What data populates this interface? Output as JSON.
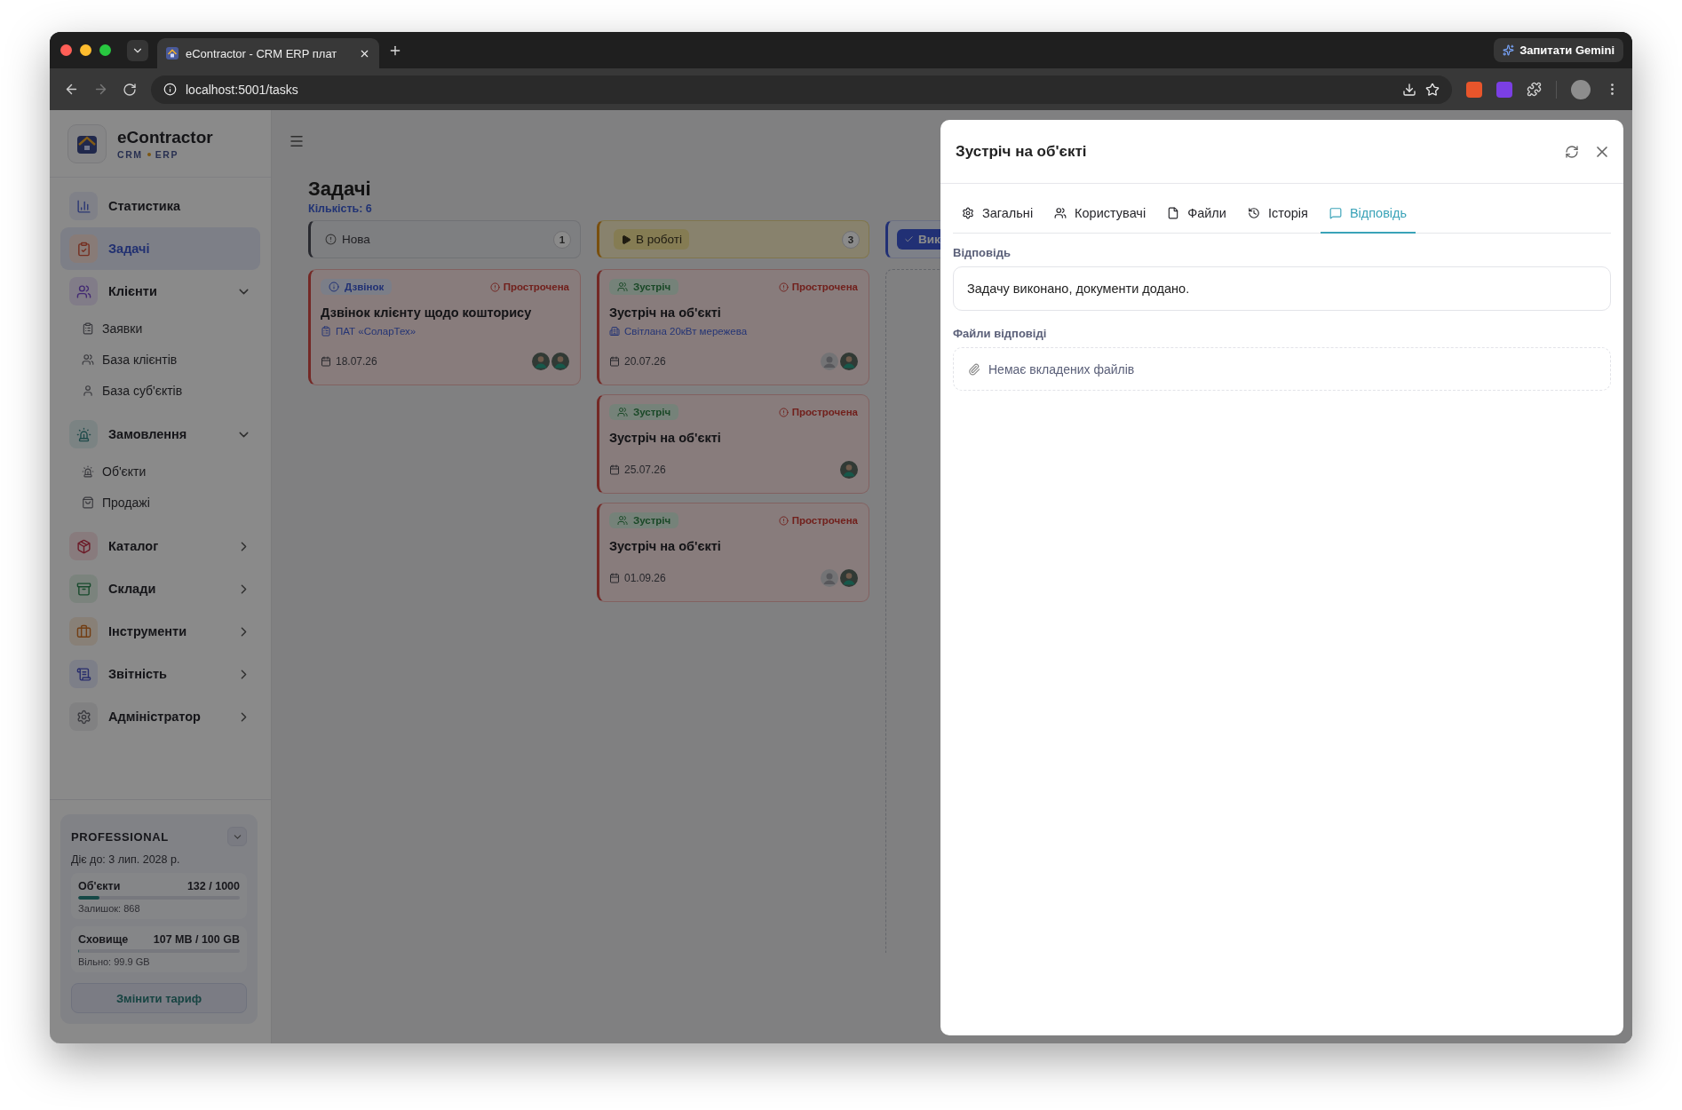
{
  "browser": {
    "tabs": [
      {
        "title": "eContractor - CRM ERP плат",
        "selected": true
      }
    ],
    "url": "localhost:5001/tasks",
    "assistant_button": "Запитати Gemini"
  },
  "sidebar": {
    "brand": "eContractor",
    "brand_sub": [
      "CRM",
      "ERP"
    ],
    "items": [
      {
        "label": "Статистика",
        "selected": false
      },
      {
        "label": "Задачі",
        "selected": true
      },
      {
        "label": "Клієнти",
        "selected": false,
        "expanded": true,
        "children": [
          {
            "label": "Заявки"
          },
          {
            "label": "База клієнтів"
          },
          {
            "label": "База суб'єктів"
          }
        ]
      },
      {
        "label": "Замовлення",
        "selected": false,
        "expanded": true,
        "children": [
          {
            "label": "Об'єкти"
          },
          {
            "label": "Продажі"
          }
        ]
      },
      {
        "label": "Каталог",
        "selected": false,
        "expanded": false
      },
      {
        "label": "Склади",
        "selected": false,
        "expanded": false
      },
      {
        "label": "Інструменти",
        "selected": false,
        "expanded": false
      },
      {
        "label": "Звітність",
        "selected": false,
        "expanded": false
      },
      {
        "label": "Адміністратор",
        "selected": false,
        "expanded": false
      }
    ],
    "plan": {
      "name": "PROFESSIONAL",
      "valid_until": "Діє до: 3 лип. 2028 р.",
      "meters": [
        {
          "label": "Об'єкти",
          "reading": "132 / 1000",
          "level": 0.132,
          "note": "Залишок: 868"
        },
        {
          "label": "Сховище",
          "reading": "107 MB / 100 GB",
          "level": 0.001,
          "note": "Вільно: 99.9 GB"
        }
      ],
      "button": "Змінити тариф"
    }
  },
  "board": {
    "title": "Задачі",
    "count": "Кількість: 6",
    "columns": [
      {
        "kind": "new",
        "title": "Нова",
        "count": "1",
        "cards": [
          {
            "kind": "call",
            "type_label": "Дзвінок",
            "status": "Прострочена",
            "title": "Дзвінок клієнту щодо кошторису",
            "link": "ПАТ «СоларТех»",
            "date": "18.07.26",
            "avatars": [
              {
                "kind": "photo"
              },
              {
                "kind": "photo"
              }
            ]
          }
        ]
      },
      {
        "kind": "progress",
        "title": "В роботі",
        "count": "3",
        "cards": [
          {
            "kind": "meeting",
            "type_label": "Зустріч",
            "status": "Прострочена",
            "title": "Зустріч на об'єкті",
            "link": "Світлана 20кВт мережева",
            "date": "20.07.26",
            "avatars": [
              {
                "kind": "default"
              },
              {
                "kind": "photo"
              }
            ]
          },
          {
            "kind": "meeting",
            "type_label": "Зустріч",
            "status": "Прострочена",
            "title": "Зустріч на об'єкті",
            "date": "25.07.26",
            "avatars": [
              {
                "kind": "photo"
              }
            ]
          },
          {
            "kind": "meeting",
            "type_label": "Зустріч",
            "status": "Прострочена",
            "title": "Зустріч на об'єкті",
            "date": "01.09.26",
            "avatars": [
              {
                "kind": "default"
              },
              {
                "kind": "photo"
              }
            ]
          }
        ]
      },
      {
        "kind": "done",
        "title": "Вик"
      }
    ]
  },
  "drawer": {
    "title": "Зустріч на об'єкті",
    "tabs": [
      {
        "label": "Загальні",
        "selected": false
      },
      {
        "label": "Користувачі",
        "selected": false
      },
      {
        "label": "Файли",
        "selected": false
      },
      {
        "label": "Історія",
        "selected": false
      },
      {
        "label": "Відповідь",
        "selected": true
      }
    ],
    "answer_label": "Відповідь",
    "answer": "Задачу виконано, документи додано.",
    "files_label": "Файли відповіді",
    "files_empty": "Немає вкладених файлів"
  }
}
